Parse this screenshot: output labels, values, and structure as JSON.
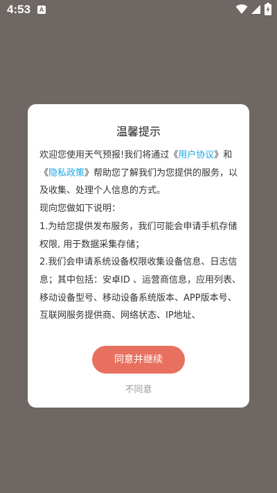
{
  "status_bar": {
    "time": "4:53",
    "notification_glyph": "A",
    "icons": [
      "wifi-icon",
      "signal-icon",
      "battery-charging-icon"
    ]
  },
  "dialog": {
    "title": "温馨提示",
    "body": {
      "p1_prefix": "欢迎您使用天气预报!我们将通过《",
      "user_agreement": "用户协议",
      "p1_mid": "》和《",
      "privacy_policy": "隐私政策",
      "p1_suffix": "》帮助您了解我们为您提供的服务，以及收集、处理个人信息的方式。",
      "p2": "现向您做如下说明：",
      "p3": "1.为给您提供发布服务，我们可能会申请手机存储权限, 用于数据采集存储；",
      "p4": "2.我们会申请系统设备权限收集设备信息、日志信息；其中包括：安卓ID 、运营商信息，应用列表、移动设备型号、移动设备系统版本、APP版本号、互联网服务提供商、网络状态、IP地址、"
    },
    "agree_label": "同意并继续",
    "disagree_label": "不同意"
  },
  "colors": {
    "overlay": "#6e6764",
    "link": "#1aa7e8",
    "primary_button": "#e8705f",
    "secondary_text": "#999999"
  }
}
